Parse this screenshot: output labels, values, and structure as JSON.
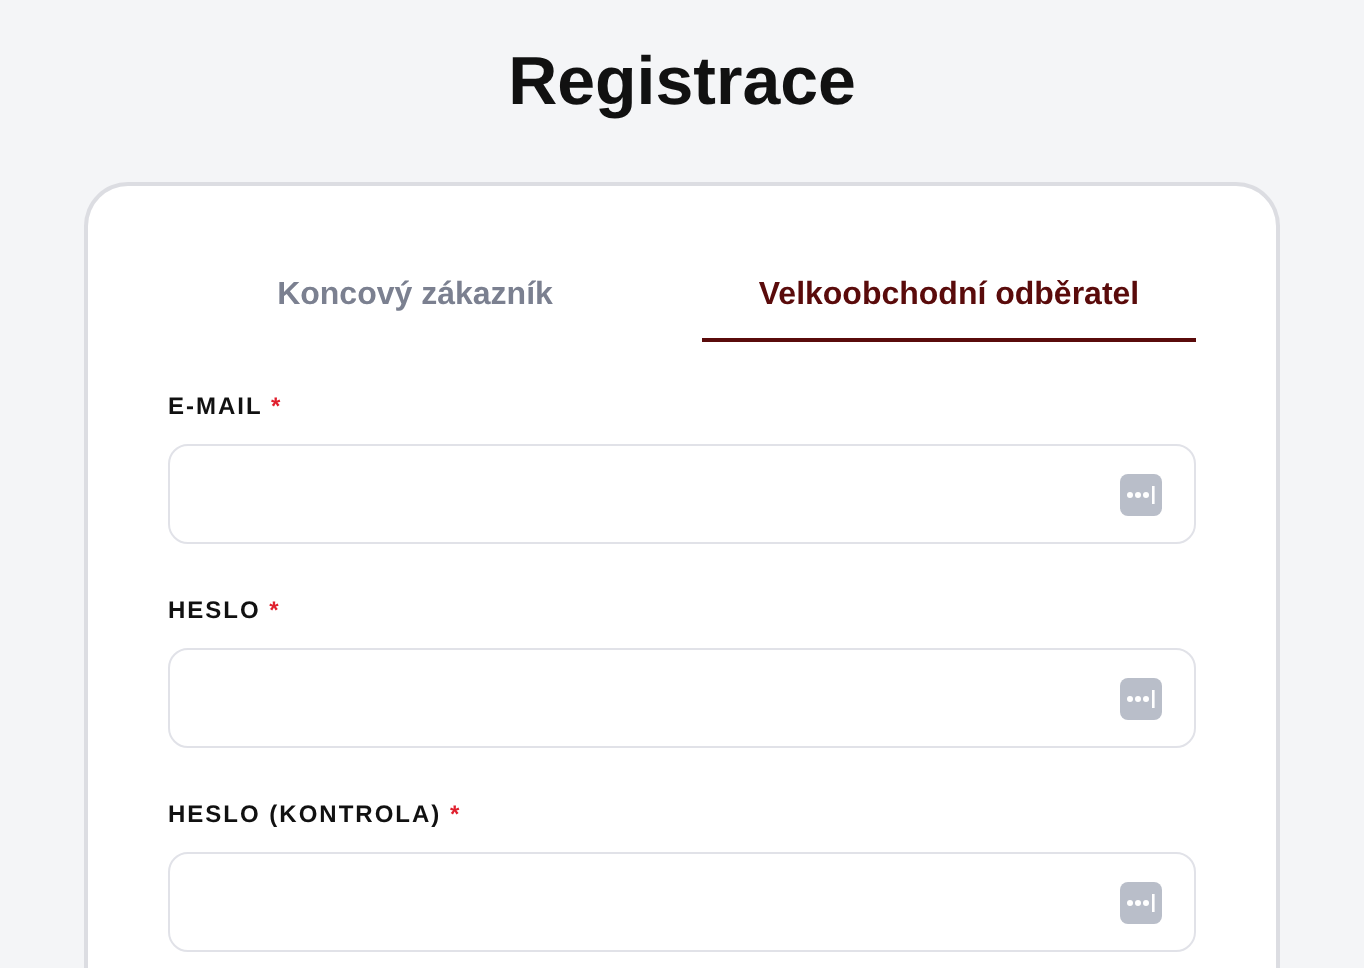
{
  "title": "Registrace",
  "tabs": [
    {
      "label": "Koncový zákazník",
      "selected": false
    },
    {
      "label": "Velkoobchodní odběratel",
      "selected": true
    }
  ],
  "fields": [
    {
      "label": "E-MAIL",
      "required_mark": "*"
    },
    {
      "label": "HESLO",
      "required_mark": "*"
    },
    {
      "label": "HESLO (KONTROLA)",
      "required_mark": "*"
    }
  ]
}
